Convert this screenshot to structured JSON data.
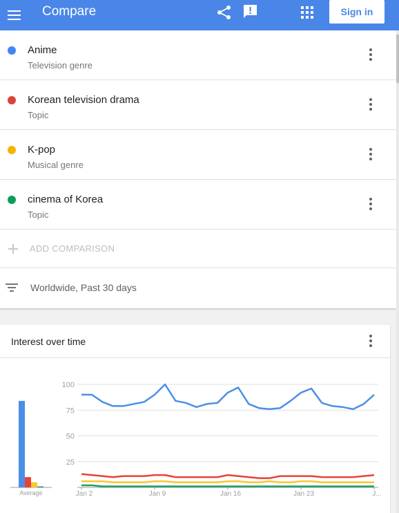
{
  "header": {
    "title": "Compare",
    "signin_label": "Sign in",
    "icons": [
      "menu-icon",
      "share-icon",
      "feedback-icon",
      "apps-icon"
    ]
  },
  "terms": [
    {
      "name": "Anime",
      "type": "Television genre",
      "color": "#4285f4"
    },
    {
      "name": "Korean television drama",
      "type": "Topic",
      "color": "#db4437"
    },
    {
      "name": "K-pop",
      "type": "Musical genre",
      "color": "#f4b400"
    },
    {
      "name": "cinema of Korea",
      "type": "Topic",
      "color": "#0f9d58"
    }
  ],
  "add_comparison_label": "ADD COMPARISON",
  "filter_text": "Worldwide, Past 30 days",
  "chart_card": {
    "title": "Interest over time"
  },
  "chart_data": {
    "type": "line",
    "title": "Interest over time",
    "y_ticks": [
      "100",
      "75",
      "50",
      "25"
    ],
    "ylim": [
      0,
      100
    ],
    "x_tick_labels": [
      "Jan 2",
      "Jan 9",
      "Jan 16",
      "Jan 23",
      "J..."
    ],
    "x_tick_index": [
      0,
      7,
      14,
      21,
      28
    ],
    "average_label": "Average",
    "grid": true,
    "series": [
      {
        "name": "Anime",
        "color": "#4a8fe7",
        "values": [
          90,
          90,
          83,
          79,
          79,
          81,
          83,
          90,
          100,
          84,
          82,
          78,
          81,
          82,
          92,
          97,
          81,
          77,
          76,
          77,
          84,
          92,
          96,
          82,
          79,
          78,
          76,
          81,
          90
        ],
        "average": 84
      },
      {
        "name": "Korean television drama",
        "color": "#e94235",
        "values": [
          13,
          12,
          11,
          10,
          11,
          11,
          11,
          12,
          12,
          10,
          10,
          10,
          10,
          10,
          12,
          11,
          10,
          9,
          9,
          11,
          11,
          11,
          11,
          10,
          10,
          10,
          10,
          11,
          12
        ],
        "average": 10
      },
      {
        "name": "K-pop",
        "color": "#f9c72f",
        "values": [
          6,
          6,
          6,
          5,
          5,
          5,
          5,
          6,
          6,
          5,
          5,
          5,
          5,
          5,
          6,
          6,
          5,
          5,
          6,
          5,
          5,
          6,
          6,
          5,
          5,
          5,
          5,
          5,
          5
        ],
        "average": 5
      },
      {
        "name": "cinema of Korea",
        "color": "#1aa260",
        "values": [
          2,
          2,
          1,
          1,
          1,
          1,
          1,
          1,
          1,
          1,
          1,
          1,
          1,
          1,
          1,
          1,
          1,
          1,
          1,
          1,
          1,
          1,
          1,
          1,
          1,
          1,
          1,
          1,
          1
        ],
        "average": 1
      }
    ]
  }
}
